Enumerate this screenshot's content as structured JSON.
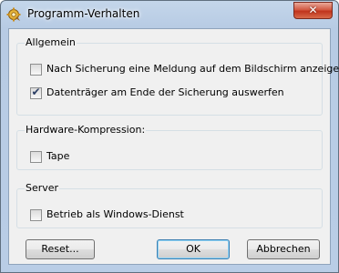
{
  "window": {
    "title": "Programm-Verhalten"
  },
  "icons": {
    "app": "gear-icon",
    "close": "close-icon"
  },
  "groups": {
    "general": {
      "label": "Allgemein",
      "items": [
        {
          "label": "Nach Sicherung eine Meldung auf dem Bildschirm anzeigen",
          "checked": false
        },
        {
          "label": "Datenträger am Ende der Sicherung auswerfen",
          "checked": true
        }
      ]
    },
    "hardware": {
      "label": "Hardware-Kompression:",
      "items": [
        {
          "label": "Tape",
          "checked": false
        }
      ]
    },
    "server": {
      "label": "Server",
      "items": [
        {
          "label": "Betrieb als Windows-Dienst",
          "checked": false
        }
      ]
    }
  },
  "buttons": {
    "reset": "Reset...",
    "ok": "OK",
    "cancel": "Abbrechen"
  },
  "colors": {
    "accent": "#3c7fb1",
    "close": "#c0341d"
  }
}
